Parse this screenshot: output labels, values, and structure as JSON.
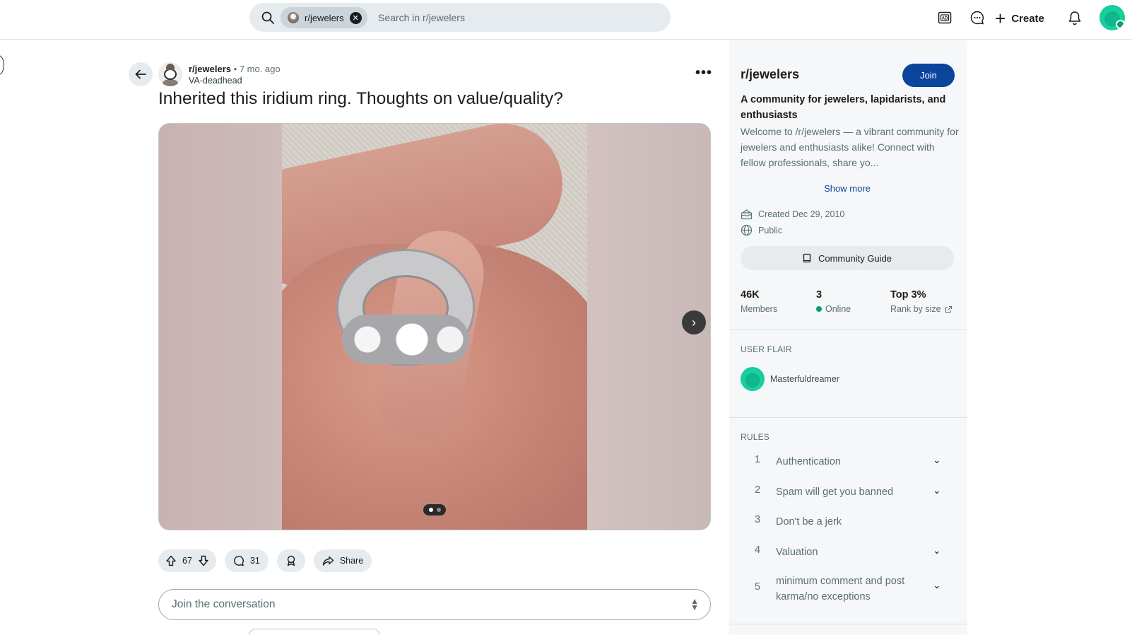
{
  "header": {
    "search_chip": "r/jewelers",
    "search_placeholder": "Search in r/jewelers",
    "create_label": "Create",
    "colors": {
      "header_bg": "#ffffff",
      "search_bg": "#e5ebee",
      "chip_bg": "#cbd4da"
    },
    "icons": [
      "search-icon",
      "close-icon",
      "advertise-icon",
      "chat-icon",
      "plus-icon",
      "notification-icon",
      "user-avatar"
    ]
  },
  "post": {
    "subreddit": "r/jewelers",
    "separator": "•",
    "age": "7 mo. ago",
    "author": "VA-deadhead",
    "title": "Inherited this iridium ring. Thoughts on value/quality?",
    "more_label": "•••",
    "gallery": {
      "page_count": 2,
      "active_page": 1
    },
    "votes": "67",
    "comments": "31",
    "share_label": "Share",
    "comment_placeholder": "Join the conversation"
  },
  "sidebar": {
    "title": "r/jewelers",
    "join_label": "Join",
    "tagline": "A community for jewelers, lapidarists, and enthusiasts",
    "description": "Welcome to /r/jewelers — a vibrant community for jewelers and enthusiasts alike! Connect with fellow professionals, share yo...",
    "show_more": "Show more",
    "created": "Created Dec 29, 2010",
    "visibility": "Public",
    "guide_label": "Community Guide",
    "stats": [
      {
        "value": "46K",
        "label": "Members"
      },
      {
        "value": "3",
        "label": "Online"
      },
      {
        "value": "Top 3%",
        "label": "Rank by size"
      }
    ],
    "user_flair_heading": "USER FLAIR",
    "flair_username": "Masterfuldreamer",
    "rules_heading": "RULES",
    "rules": [
      {
        "num": "1",
        "text": "Authentication",
        "expandable": true
      },
      {
        "num": "2",
        "text": "Spam will get you banned",
        "expandable": true
      },
      {
        "num": "3",
        "text": "Don't be a jerk",
        "expandable": false
      },
      {
        "num": "4",
        "text": "Valuation",
        "expandable": true
      },
      {
        "num": "5",
        "text": "minimum comment and post karma/no exceptions",
        "expandable": true
      }
    ],
    "colors": {
      "join_bg": "#0a449b",
      "sidebar_bg": "#f6f7f8",
      "online_dot": "#01a368"
    }
  }
}
